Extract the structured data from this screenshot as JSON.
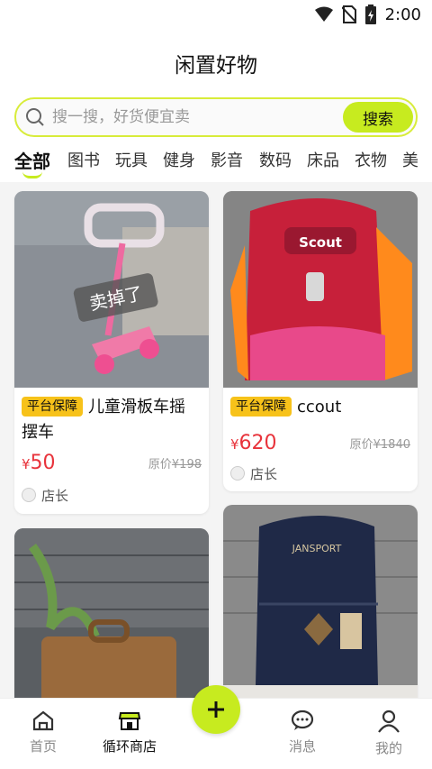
{
  "status_bar": {
    "time": "2:00",
    "icons": [
      "wifi-icon",
      "no-sim-icon",
      "battery-icon"
    ]
  },
  "header": {
    "title": "闲置好物"
  },
  "search": {
    "placeholder": "搜一搜，好货便宜卖",
    "button_label": "搜索"
  },
  "tabs": [
    {
      "label": "全部",
      "active": true
    },
    {
      "label": "图书"
    },
    {
      "label": "玩具"
    },
    {
      "label": "健身"
    },
    {
      "label": "影音"
    },
    {
      "label": "数码"
    },
    {
      "label": "床品"
    },
    {
      "label": "衣物"
    },
    {
      "label": "美"
    }
  ],
  "items": [
    {
      "badge": "平台保障",
      "title_first_line": "儿童滑板车摇",
      "title_second_line": "摆车",
      "currency": "¥",
      "price": "50",
      "original_prefix": "原价",
      "original_price": "¥198",
      "seller": "店长",
      "image_stamp": "卖掉了"
    },
    {
      "badge": "平台保障",
      "title_first_line": "ccout",
      "currency": "¥",
      "price": "620",
      "original_prefix": "原价",
      "original_price": "¥1840",
      "seller": "店长",
      "image_brand": "Scout"
    },
    {
      "image": "wicker-suitcase"
    },
    {
      "image": "navy-backpack",
      "image_brand": "JANSPORT"
    }
  ],
  "bottom_nav": [
    {
      "label": "首页",
      "icon": "home-icon"
    },
    {
      "label": "循环商店",
      "icon": "store-icon",
      "active": true
    },
    {
      "label": "消息",
      "icon": "message-icon"
    },
    {
      "label": "我的",
      "icon": "profile-icon"
    }
  ],
  "fab": {
    "icon": "plus-icon"
  },
  "colors": {
    "accent": "#c7eb1f",
    "badge": "#f7c21a",
    "price": "#e8333b"
  }
}
